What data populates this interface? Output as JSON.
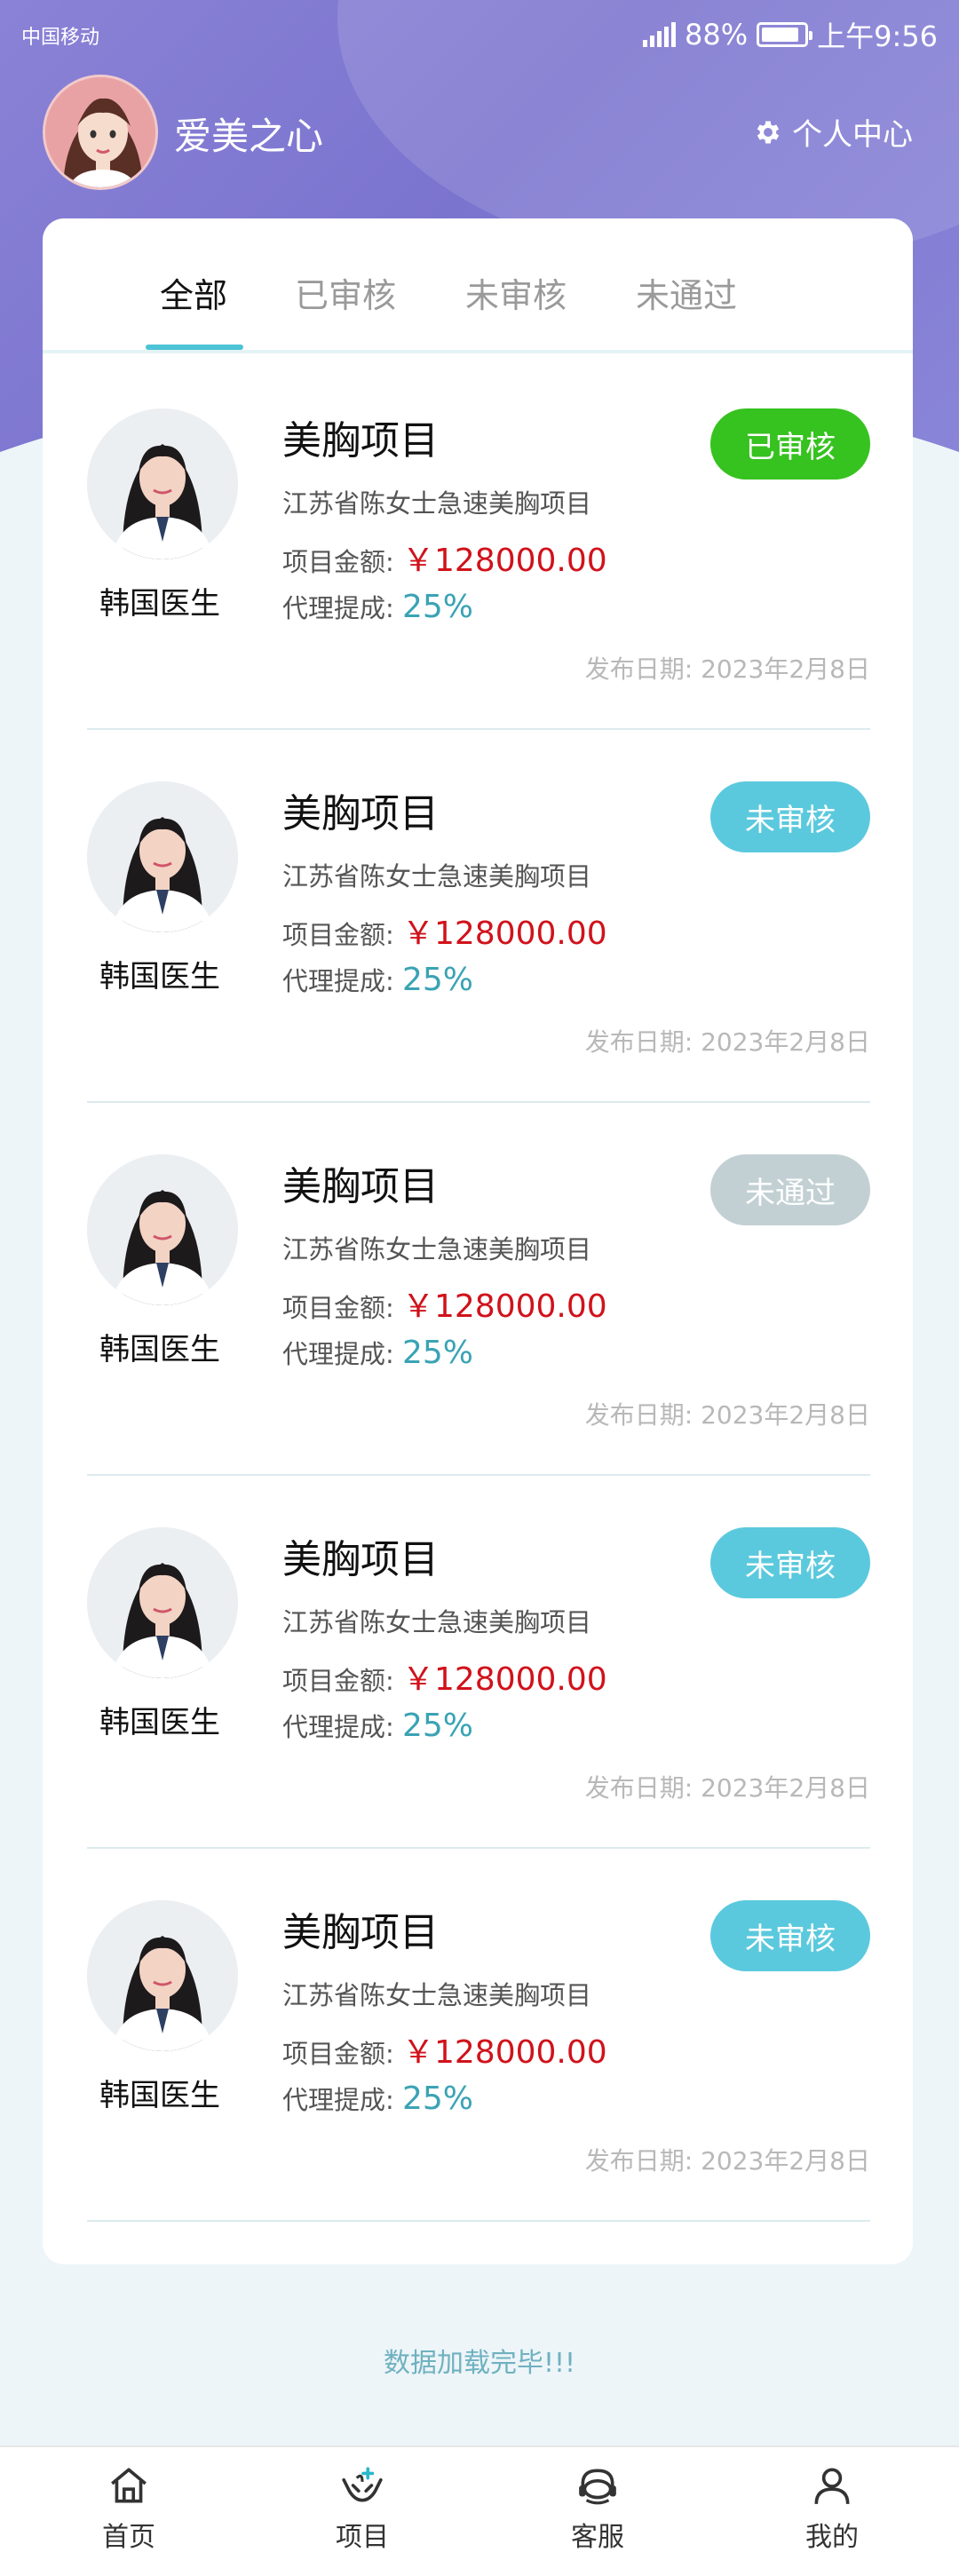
{
  "statusbar": {
    "carrier": "中国移动",
    "battery": "88%",
    "time": "上午9:56"
  },
  "profile": {
    "username": "爱美之心",
    "personal_center": "个人中心"
  },
  "tabs": [
    {
      "label": "全部"
    },
    {
      "label": "已审核"
    },
    {
      "label": "未审核"
    },
    {
      "label": "未通过"
    }
  ],
  "amount_label": "项目金额:",
  "rate_label": "代理提成:",
  "date_label": "发布日期:",
  "items": [
    {
      "doctor": "韩国医生",
      "title": "美胸项目",
      "desc": "江苏省陈女士急速美胸项目",
      "amount": "￥128000.00",
      "rate": "25%",
      "date": "2023年2月8日",
      "status": "已审核"
    },
    {
      "doctor": "韩国医生",
      "title": "美胸项目",
      "desc": "江苏省陈女士急速美胸项目",
      "amount": "￥128000.00",
      "rate": "25%",
      "date": "2023年2月8日",
      "status": "未审核"
    },
    {
      "doctor": "韩国医生",
      "title": "美胸项目",
      "desc": "江苏省陈女士急速美胸项目",
      "amount": "￥128000.00",
      "rate": "25%",
      "date": "2023年2月8日",
      "status": "未通过"
    },
    {
      "doctor": "韩国医生",
      "title": "美胸项目",
      "desc": "江苏省陈女士急速美胸项目",
      "amount": "￥128000.00",
      "rate": "25%",
      "date": "2023年2月8日",
      "status": "未审核"
    },
    {
      "doctor": "韩国医生",
      "title": "美胸项目",
      "desc": "江苏省陈女士急速美胸项目",
      "amount": "￥128000.00",
      "rate": "25%",
      "date": "2023年2月8日",
      "status": "未审核"
    }
  ],
  "status_colors": {
    "已审核": "#36c21f",
    "未审核": "#5bc9dd",
    "未通过": "#c3d0d3"
  },
  "footer_note": "数据加载完毕!!!",
  "nav": [
    {
      "label": "首页",
      "icon": "home-icon"
    },
    {
      "label": "项目",
      "icon": "hands-icon"
    },
    {
      "label": "客服",
      "icon": "headset-icon"
    },
    {
      "label": "我的",
      "icon": "user-icon"
    }
  ]
}
